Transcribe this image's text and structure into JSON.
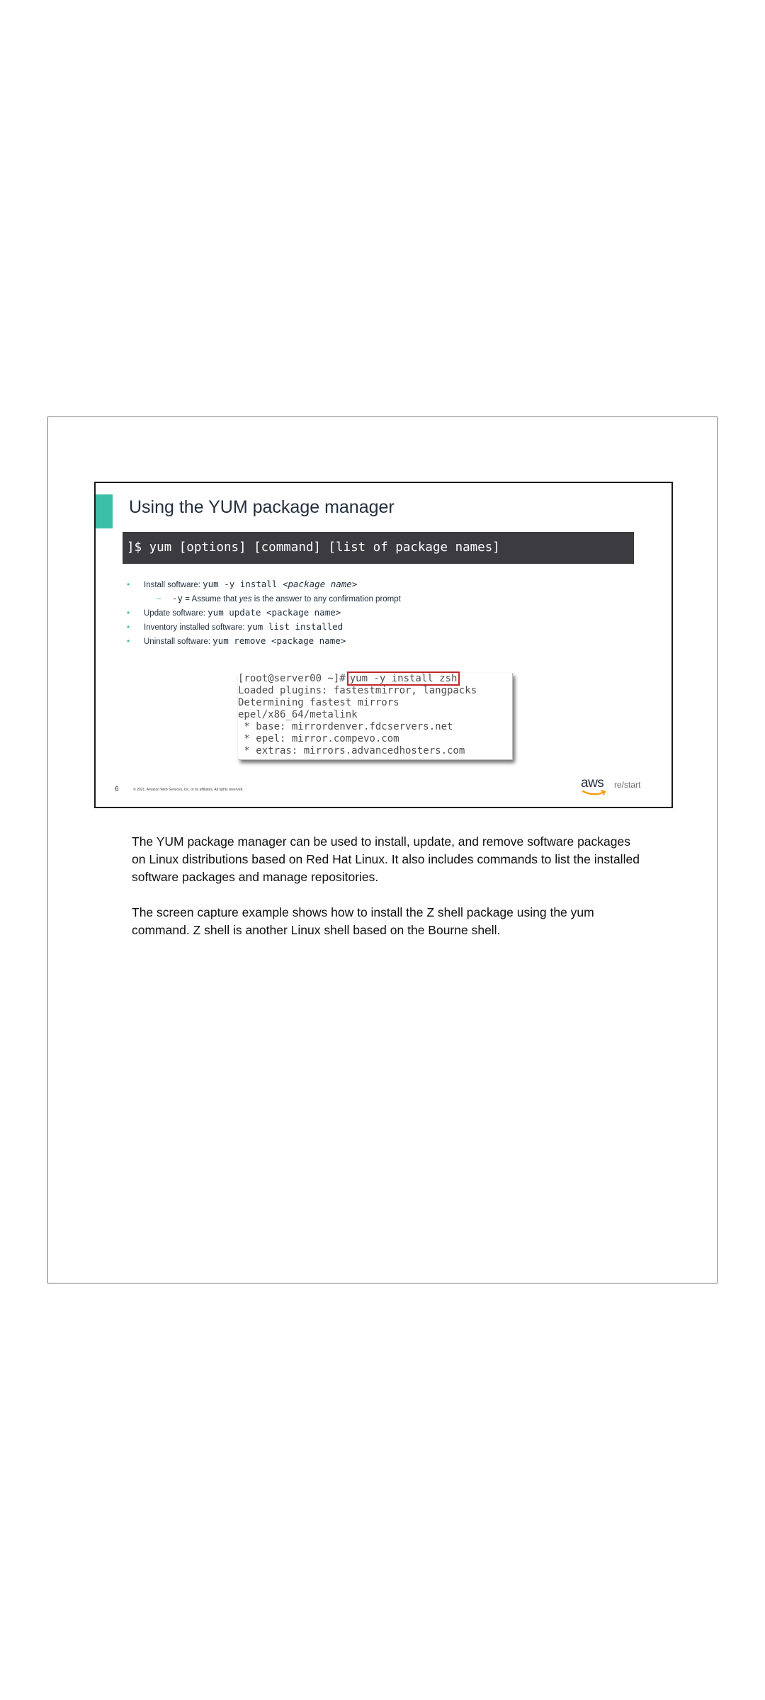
{
  "slide": {
    "title": "Using the YUM package manager",
    "syntax": "]$ yum [options] [command] [list of package names]",
    "bullets": [
      {
        "label": "Install software: ",
        "cmd": "yum -y install ",
        "cmd_italic": "<package name>"
      },
      {
        "flag": "-y",
        "text_before": " = Assume that ",
        "italic": "yes",
        "text_after": " is the answer to any confirmation prompt"
      },
      {
        "label": "Update software: ",
        "cmd": "yum update <package name>"
      },
      {
        "label": "Inventory installed software: ",
        "cmd": "yum list installed"
      },
      {
        "label": "Uninstall software: ",
        "cmd": "yum remove <package name>"
      }
    ],
    "terminal": {
      "prompt": "[root@server00 ~]#",
      "command": "yum -y install zsh",
      "lines": [
        "Loaded plugins: fastestmirror, langpacks",
        "Determining fastest mirrors",
        "epel/x86_64/metalink",
        " * base: mirrordenver.fdcservers.net",
        " * epel: mirror.compevo.com",
        " * extras: mirrors.advancedhosters.com"
      ]
    },
    "slide_number": "6",
    "copyright": "© 2021, Amazon Web Services, Inc. or its affiliates. All rights reserved.",
    "logo": {
      "aws": "aws",
      "restart": "re/start",
      "smile_color": "#ff9900"
    },
    "accent_color": "#3cbfa8",
    "highlight_color": "#c0292b"
  },
  "notes": {
    "paragraph1": "The YUM package manager can be used to install, update, and remove software packages on Linux distributions based on Red Hat Linux. It also includes commands to list the installed software packages and manage repositories.",
    "paragraph2": "The screen capture example shows how to install the Z shell package using the yum command. Z shell is another Linux shell based on the Bourne shell."
  }
}
